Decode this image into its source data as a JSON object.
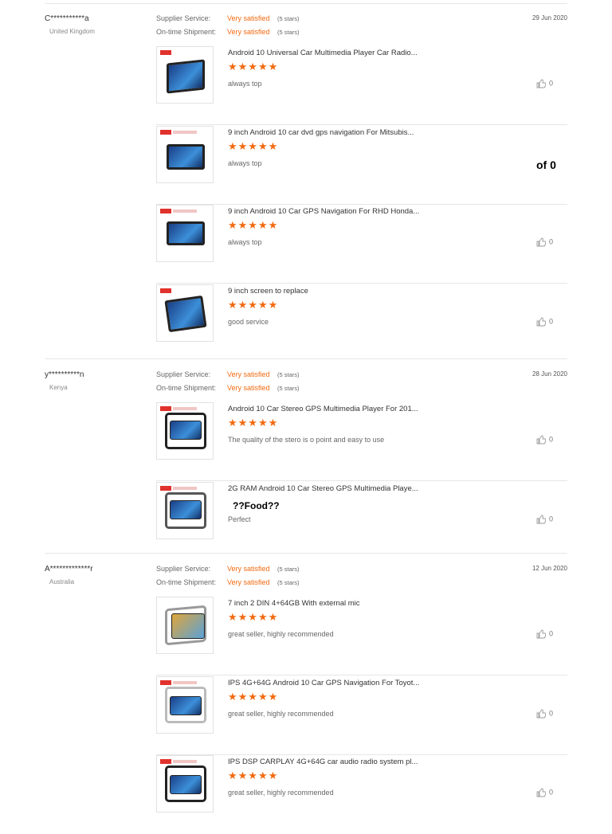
{
  "reviews": [
    {
      "buyer": "C***********a",
      "country": "United Kingdom",
      "date": "29 Jun 2020",
      "supplier_label": "Supplier Service:",
      "supplier_value": "Very satisfied",
      "supplier_stars": "(5 stars)",
      "shipment_label": "On-time Shipment:",
      "shipment_value": "Very satisfied",
      "shipment_stars": "(5 stars)",
      "items": [
        {
          "title": "Android 10 Universal Car Multimedia Player Car Radio...",
          "stars": 5,
          "comment": "always top",
          "helpful": "0"
        },
        {
          "title": "9 inch Android 10 car dvd gps navigation For Mitsubis...",
          "stars": 5,
          "comment": "always top",
          "helpful": ""
        },
        {
          "title": "9 inch Android 10 Car GPS Navigation For RHD Honda...",
          "stars": 5,
          "comment": "always top",
          "helpful": "0"
        },
        {
          "title": "9 inch screen to replace",
          "stars": 5,
          "comment": "good service",
          "helpful": "0"
        }
      ]
    },
    {
      "buyer": "y**********n",
      "country": "Kenya",
      "date": "28 Jun 2020",
      "supplier_label": "Supplier Service:",
      "supplier_value": "Very satisfied",
      "supplier_stars": "(5 stars)",
      "shipment_label": "On-time Shipment:",
      "shipment_value": "Very satisfied",
      "shipment_stars": "(5 stars)",
      "items": [
        {
          "title": "Android 10 Car Stereo GPS Multimedia Player For 201...",
          "stars": 5,
          "comment": "The quality of the stero is o point and easy to use",
          "helpful": "0"
        },
        {
          "title": "2G RAM Android 10 Car Stereo GPS Multimedia Playe...",
          "stars": 5,
          "comment": "Perfect",
          "helpful": "0"
        }
      ]
    },
    {
      "buyer": "A*************r",
      "country": "Australia",
      "date": "12 Jun 2020",
      "supplier_label": "Supplier Service:",
      "supplier_value": "Very satisfied",
      "supplier_stars": "(5 stars)",
      "shipment_label": "On-time Shipment:",
      "shipment_value": "Very satisfied",
      "shipment_stars": "(5 stars)",
      "items": [
        {
          "title": "7 inch 2 DIN 4+64GB With external mic",
          "stars": 5,
          "comment": "great seller, highly recommended",
          "helpful": "0"
        },
        {
          "title": "IPS 4G+64G Android 10 Car GPS Navigation For Toyot...",
          "stars": 5,
          "comment": "great seller, highly recommended",
          "helpful": "0"
        },
        {
          "title": "IPS DSP CARPLAY 4G+64G car audio radio system pl...",
          "stars": 5,
          "comment": "great seller, highly recommended",
          "helpful": "0"
        }
      ]
    }
  ],
  "overlays": {
    "of_text": "of 0",
    "food_text": "??Food??"
  },
  "colors": {
    "accent": "#f26a10",
    "divider": "#e6e6e6"
  },
  "icons": {
    "star": "star-icon",
    "helpful": "thumbs-up-icon"
  }
}
